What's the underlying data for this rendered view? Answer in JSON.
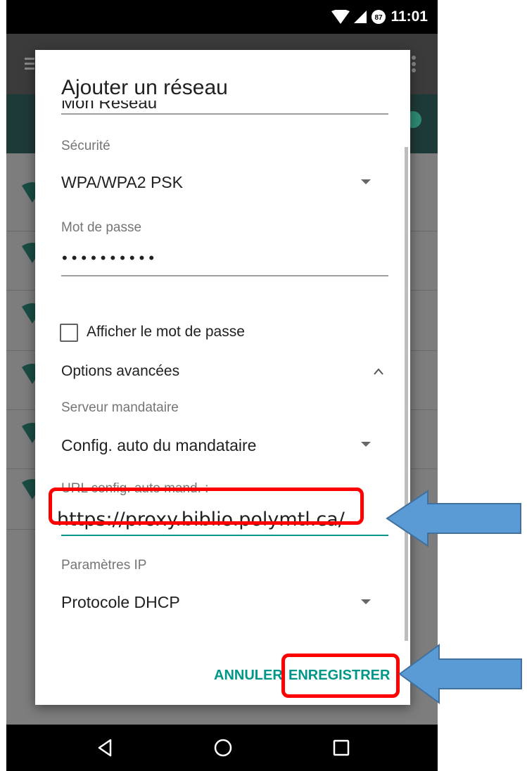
{
  "status_bar": {
    "time": "11:01",
    "notification_badge": "87"
  },
  "dialog": {
    "title": "Ajouter un réseau",
    "network_name": "Mon Réseau",
    "security": {
      "label": "Sécurité",
      "value": "WPA/WPA2 PSK"
    },
    "password": {
      "label": "Mot de passe",
      "masked_value": "••••••••••"
    },
    "show_password": {
      "label": "Afficher le mot de passe",
      "checked": false
    },
    "advanced": {
      "label": "Options avancées",
      "expanded": true
    },
    "proxy": {
      "label": "Serveur mandataire",
      "value": "Config. auto du mandataire"
    },
    "pac_url": {
      "label": "URL config. auto mand. :",
      "value": "https://proxy.biblio.polymtl.ca/"
    },
    "ip_settings": {
      "label": "Paramètres IP",
      "value": "Protocole DHCP"
    },
    "buttons": {
      "cancel": "ANNULER",
      "save": "ENREGISTRER"
    }
  },
  "navigation": {
    "icons": [
      "back-icon",
      "home-icon",
      "recents-icon"
    ]
  },
  "colors": {
    "accent": "#009688",
    "highlight": "#ff0000",
    "arrow": "#5b9bd5",
    "arrow_outline": "#41719c"
  }
}
